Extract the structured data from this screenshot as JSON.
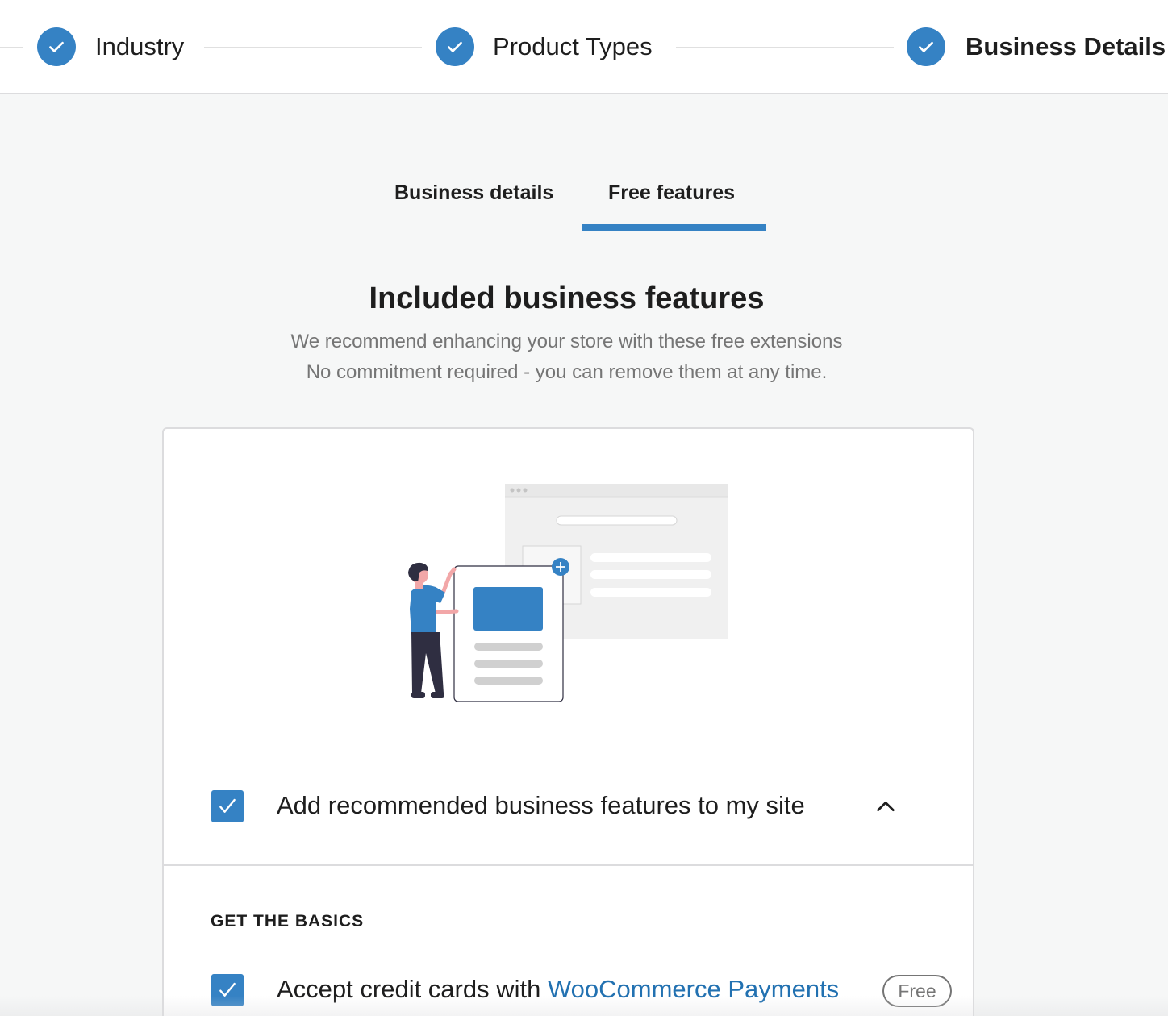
{
  "stepper": {
    "steps": [
      {
        "label": "Industry",
        "state": "complete"
      },
      {
        "label": "Product Types",
        "state": "complete"
      },
      {
        "label": "Business Details",
        "state": "current"
      }
    ]
  },
  "tabs": [
    {
      "label": "Business details",
      "active": false
    },
    {
      "label": "Free features",
      "active": true
    }
  ],
  "main": {
    "heading": "Included business features",
    "subtitle_line1": "We recommend enhancing your store with these free extensions",
    "subtitle_line2": "No commitment required - you can remove them at any time."
  },
  "card": {
    "master_option": {
      "label": "Add recommended business features to my site",
      "checked": true,
      "expanded": true
    },
    "section_title": "GET THE BASICS",
    "items": [
      {
        "label_prefix": "Accept credit cards with ",
        "link_text": "WooCommerce Payments",
        "badge": "Free",
        "checked": true
      }
    ]
  },
  "colors": {
    "accent": "#3582c4",
    "link": "#2271b1",
    "background": "#f6f7f7"
  }
}
